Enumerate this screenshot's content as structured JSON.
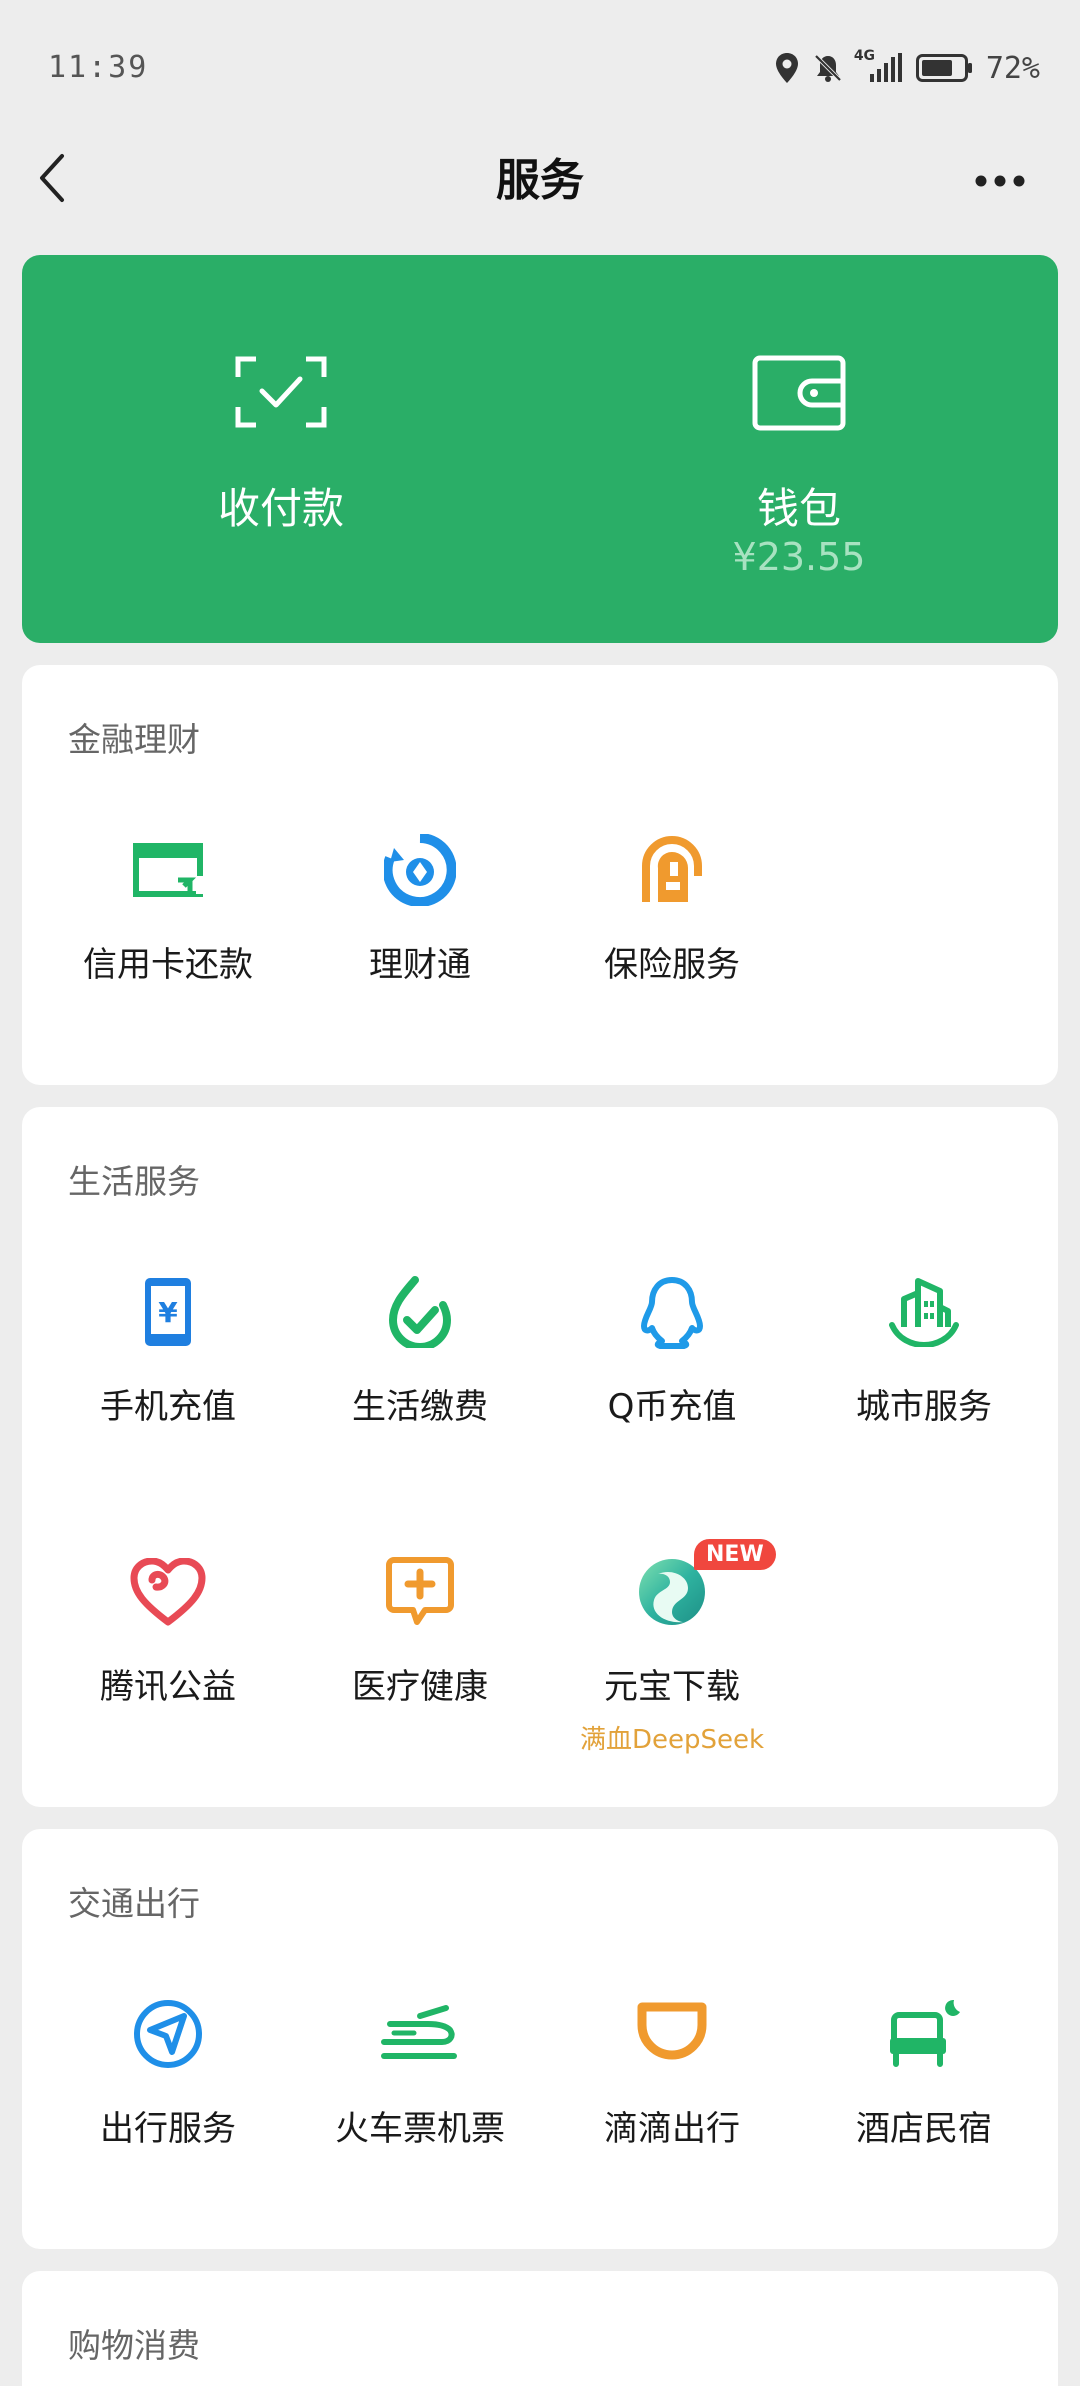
{
  "status_bar": {
    "time": "11:39",
    "network": "4G",
    "battery": "72%"
  },
  "nav": {
    "title": "服务"
  },
  "wallet_card": {
    "accent_color": "#2aae67",
    "pay": {
      "label": "收付款",
      "icon": "scan-check-icon"
    },
    "wallet": {
      "label": "钱包",
      "balance": "¥23.55",
      "icon": "wallet-icon"
    }
  },
  "sections": {
    "finance": {
      "title": "金融理财",
      "items": [
        {
          "label": "信用卡还款",
          "icon": "credit-card-icon"
        },
        {
          "label": "理财通",
          "icon": "wealth-icon"
        },
        {
          "label": "保险服务",
          "icon": "insurance-icon"
        }
      ]
    },
    "life": {
      "title": "生活服务",
      "items": [
        {
          "label": "手机充值",
          "icon": "phone-topup-icon"
        },
        {
          "label": "生活缴费",
          "icon": "utility-bill-icon"
        },
        {
          "label": "Q币充值",
          "icon": "qq-penguin-icon"
        },
        {
          "label": "城市服务",
          "icon": "city-icon"
        },
        {
          "label": "腾讯公益",
          "icon": "charity-heart-icon"
        },
        {
          "label": "医疗健康",
          "icon": "medical-icon"
        },
        {
          "label": "元宝下载",
          "icon": "yuanbao-icon",
          "badge": "NEW",
          "sub": "满血DeepSeek"
        }
      ]
    },
    "transport": {
      "title": "交通出行",
      "items": [
        {
          "label": "出行服务",
          "icon": "navigation-icon"
        },
        {
          "label": "火车票机票",
          "icon": "train-icon"
        },
        {
          "label": "滴滴出行",
          "icon": "didi-icon"
        },
        {
          "label": "酒店民宿",
          "icon": "hotel-bed-icon"
        }
      ]
    },
    "shopping": {
      "title": "购物消费"
    }
  }
}
